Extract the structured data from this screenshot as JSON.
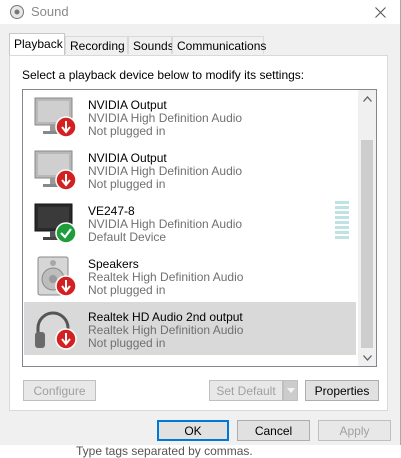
{
  "window": {
    "title": "Sound"
  },
  "tabs": [
    {
      "label": "Playback",
      "active": true
    },
    {
      "label": "Recording",
      "active": false
    },
    {
      "label": "Sounds",
      "active": false
    },
    {
      "label": "Communications",
      "active": false
    }
  ],
  "instruction": "Select a playback device below to modify its settings:",
  "devices": [
    {
      "name": "NVIDIA Output",
      "driver": "NVIDIA High Definition Audio",
      "status": "Not plugged in",
      "icon": "monitor-icon",
      "badge": "not-plugged-in-icon",
      "selected": false
    },
    {
      "name": "NVIDIA Output",
      "driver": "NVIDIA High Definition Audio",
      "status": "Not plugged in",
      "icon": "monitor-icon",
      "badge": "not-plugged-in-icon",
      "selected": false
    },
    {
      "name": "VE247-8",
      "driver": "NVIDIA High Definition Audio",
      "status": "Default Device",
      "icon": "monitor-icon",
      "badge": "default-checkmark-icon",
      "selected": false
    },
    {
      "name": "Speakers",
      "driver": "Realtek High Definition Audio",
      "status": "Not plugged in",
      "icon": "speaker-icon",
      "badge": "not-plugged-in-icon",
      "selected": false
    },
    {
      "name": "Realtek HD Audio 2nd output",
      "driver": "Realtek High Definition Audio",
      "status": "Not plugged in",
      "icon": "headphones-icon",
      "badge": "not-plugged-in-icon",
      "selected": true
    }
  ],
  "buttons": {
    "configure": "Configure",
    "set_default": "Set Default",
    "properties": "Properties",
    "ok": "OK",
    "cancel": "Cancel",
    "apply": "Apply"
  },
  "background_text": "Type tags separated by commas.",
  "colors": {
    "not_plugged_badge": "#d32020",
    "default_badge": "#1e9e3a",
    "selection": "#d9d9d9",
    "default_button_border": "#0078d7"
  }
}
